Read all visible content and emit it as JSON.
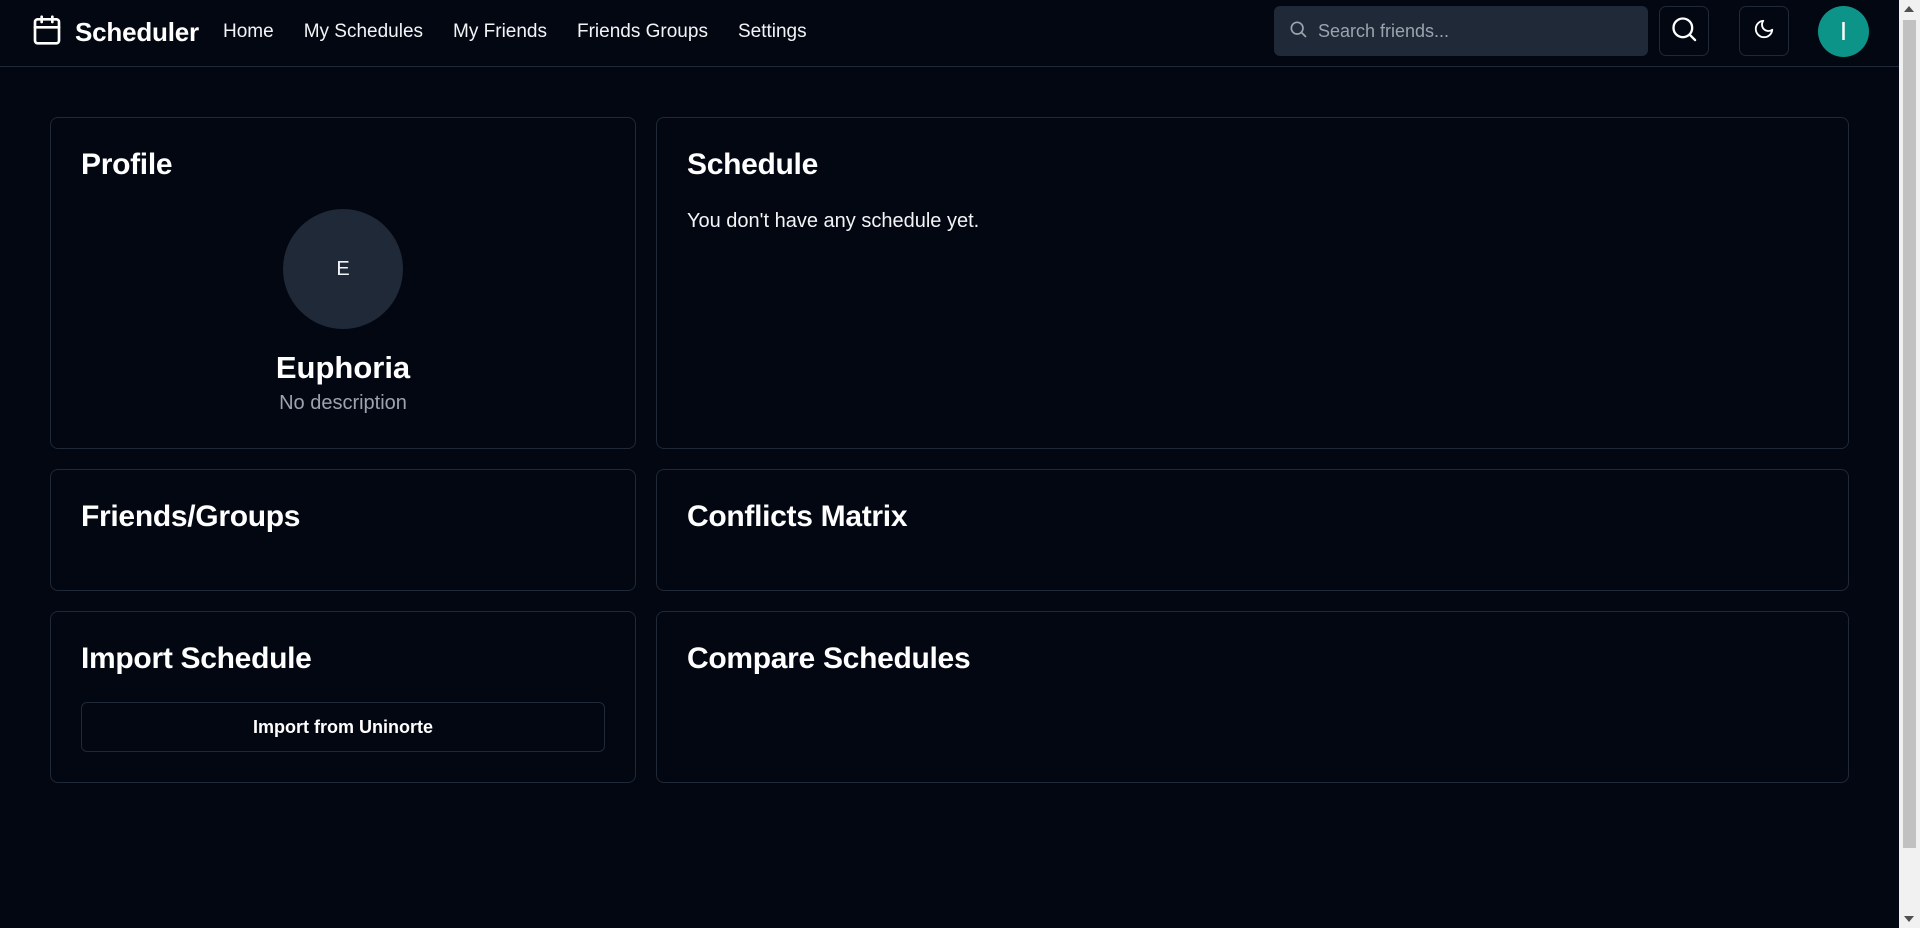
{
  "app": {
    "name": "Scheduler"
  },
  "nav": {
    "items": [
      {
        "label": "Home"
      },
      {
        "label": "My Schedules"
      },
      {
        "label": "My Friends"
      },
      {
        "label": "Friends Groups"
      },
      {
        "label": "Settings"
      }
    ]
  },
  "search": {
    "placeholder": "Search friends...",
    "value": ""
  },
  "header": {
    "search_button_icon": "search-icon",
    "theme_toggle_icon": "moon-icon",
    "user_initial": "I",
    "user_avatar_color": "#0d9488"
  },
  "profile": {
    "title": "Profile",
    "avatar_initial": "E",
    "name": "Euphoria",
    "description": "No description"
  },
  "schedule": {
    "title": "Schedule",
    "empty_message": "You don't have any schedule yet."
  },
  "friends_groups": {
    "title": "Friends/Groups"
  },
  "conflicts": {
    "title": "Conflicts Matrix"
  },
  "import": {
    "title": "Import Schedule",
    "button_label": "Import from Uninorte"
  },
  "compare": {
    "title": "Compare Schedules"
  },
  "theme": {
    "background": "#030712",
    "border": "#1f2937",
    "muted_text": "#9ca3af"
  }
}
